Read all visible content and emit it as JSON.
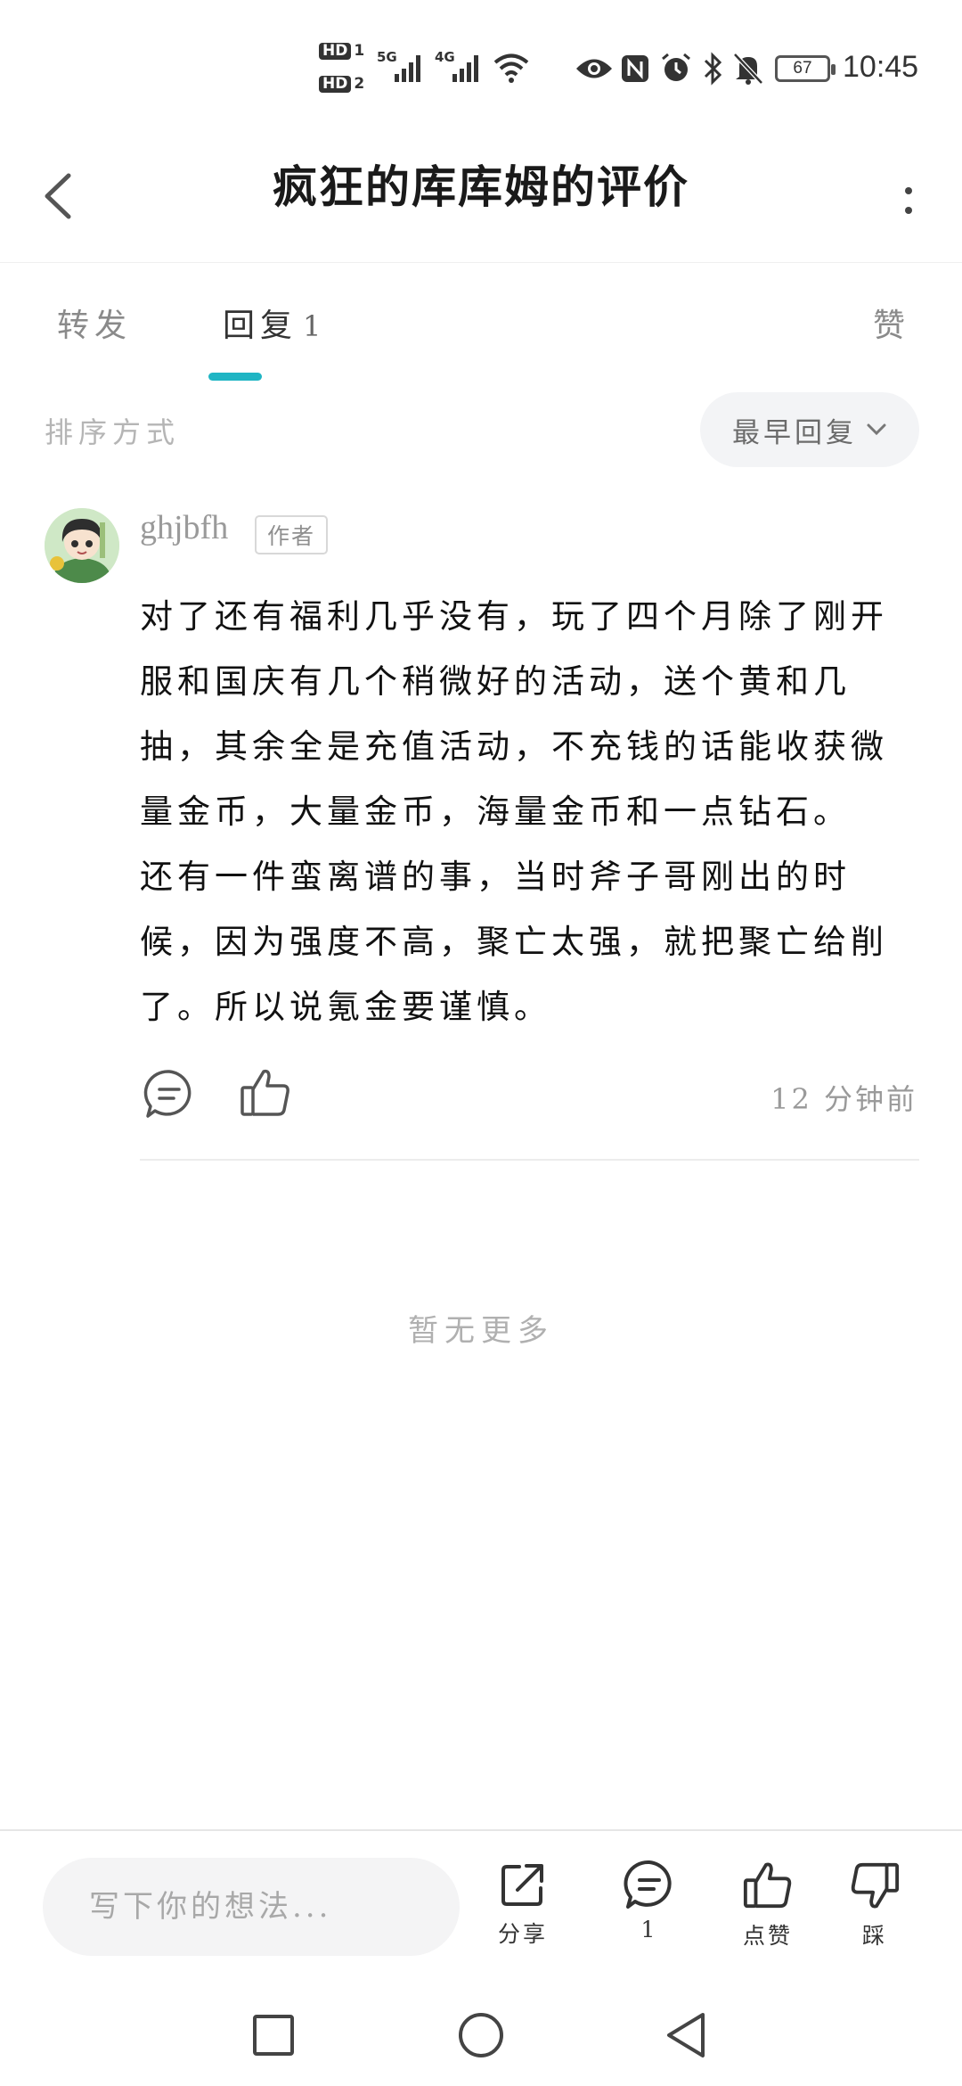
{
  "status_bar": {
    "hd1": "HD",
    "hd1_num": "1",
    "hd2": "HD",
    "hd2_num": "2",
    "net1": "5G",
    "net2": "4G",
    "battery": "67",
    "time": "10:45",
    "icons": [
      "eye-icon",
      "nfc-icon",
      "alarm-icon",
      "bluetooth-icon",
      "mute-icon"
    ]
  },
  "header": {
    "title": "疯狂的库库姆的评价",
    "back_icon": "chevron-left-icon",
    "more_icon": "more-vertical-icon"
  },
  "tabs": {
    "items": [
      {
        "label": "转发",
        "count": ""
      },
      {
        "label": "回复",
        "count": "1"
      },
      {
        "label": "赞",
        "count": ""
      }
    ],
    "active_index": 1,
    "accent_color": "#1fb5c4"
  },
  "sort": {
    "label": "排序方式",
    "selected": "最早回复"
  },
  "comment": {
    "username": "ghjbfh",
    "badge": "作者",
    "paragraphs": [
      "对了还有福利几乎没有，玩了四个月除了刚开服和国庆有几个稍微好的活动，送个黄和几抽，其余全是充值活动，不充钱的话能收获微量金币，大量金币，海量金币和一点钻石。",
      "还有一件蛮离谱的事，当时斧子哥刚出的时候，因为强度不高，聚亡太强，就把聚亡给削了。所以说氪金要谨慎。"
    ],
    "time_ago": "12 分钟前"
  },
  "list_footer": "暂无更多",
  "bottom_bar": {
    "input_placeholder": "写下你的想法...",
    "share_label": "分享",
    "comment_count": "1",
    "like_label": "点赞",
    "dislike_label": "踩"
  }
}
